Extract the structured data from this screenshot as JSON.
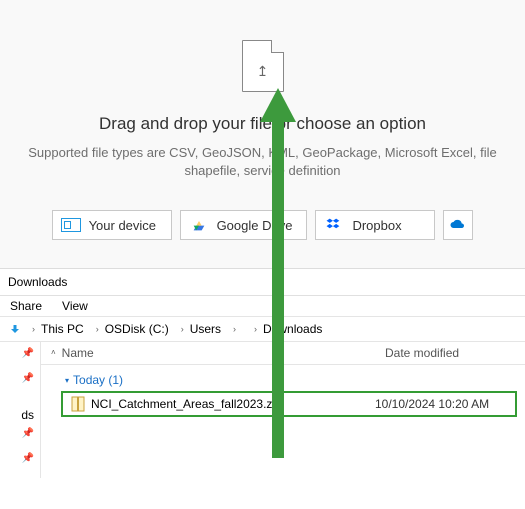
{
  "upload": {
    "title": "Drag and drop your file or choose an option",
    "subtitle": "Supported file types are CSV, GeoJSON, KML, GeoPackage, Microsoft Excel, file shapefile, service definition",
    "sources": {
      "device": "Your device",
      "gdrive": "Google Drive",
      "dropbox": "Dropbox"
    }
  },
  "explorer": {
    "folder_title": "Downloads",
    "tabs": {
      "share": "Share",
      "view": "View"
    },
    "breadcrumb": [
      "This PC",
      "OSDisk (C:)",
      "Users",
      "",
      "Downloads"
    ],
    "columns": {
      "name": "Name",
      "date": "Date modified"
    },
    "left_truncated": "ds",
    "group": {
      "label": "Today (1)"
    },
    "files": [
      {
        "name": "NCI_Catchment_Areas_fall2023.zip",
        "modified": "10/10/2024 10:20 AM"
      }
    ]
  }
}
